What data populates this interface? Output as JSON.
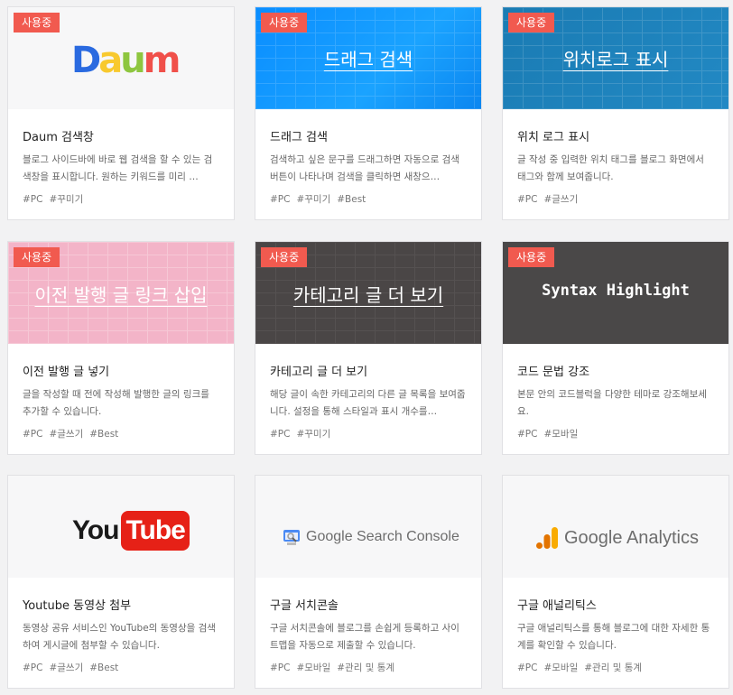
{
  "badge_label": "사용중",
  "cards": [
    {
      "title": "Daum 검색창",
      "description": "블로그 사이드바에 바로 웹 검색을 할 수 있는 검색창을 표시합니다. 원하는 키워드를 미리 …",
      "tags": [
        "#PC",
        "#꾸미기"
      ],
      "thumb": {
        "type": "logo",
        "text": "Daum",
        "letters": [
          "D",
          "a",
          "u",
          "m"
        ]
      }
    },
    {
      "title": "드래그 검색",
      "description": "검색하고 싶은 문구를 드래그하면 자동으로 검색 버튼이 나타나며 검색을 클릭하면 새창으…",
      "tags": [
        "#PC",
        "#꾸미기",
        "#Best"
      ],
      "thumb": {
        "type": "text",
        "text": "드래그 검색"
      }
    },
    {
      "title": "위치 로그 표시",
      "description": "글 작성 중 입력한 위치 태그를 블로그 화면에서 태그와 함께 보여줍니다.",
      "tags": [
        "#PC",
        "#글쓰기"
      ],
      "thumb": {
        "type": "text",
        "text": "위치로그 표시"
      }
    },
    {
      "title": "이전 발행 글 넣기",
      "description": "글을 작성할 때 전에 작성해 발행한 글의 링크를 추가할 수 있습니다.",
      "tags": [
        "#PC",
        "#글쓰기",
        "#Best"
      ],
      "thumb": {
        "type": "text",
        "text": "이전 발행 글 링크 삽입"
      }
    },
    {
      "title": "카테고리 글 더 보기",
      "description": "해당 글이 속한 카테고리의 다른 글 목록을 보여줍니다. 설정을 통해 스타일과 표시 개수를…",
      "tags": [
        "#PC",
        "#꾸미기"
      ],
      "thumb": {
        "type": "text",
        "text": "카테고리 글 더 보기"
      }
    },
    {
      "title": "코드 문법 강조",
      "description": "본문 안의 코드블럭을 다양한 테마로 강조해보세요.",
      "tags": [
        "#PC",
        "#모바일"
      ],
      "thumb": {
        "type": "code",
        "text": "Syntax Highlight"
      }
    },
    {
      "title": "Youtube 동영상 첨부",
      "description": "동영상 공유 서비스인 YouTube의 동영상을 검색하여 게시글에 첨부할 수 있습니다.",
      "tags": [
        "#PC",
        "#글쓰기",
        "#Best"
      ],
      "thumb": {
        "type": "logo",
        "text_a": "You",
        "text_b": "Tube"
      }
    },
    {
      "title": "구글 서치콘솔",
      "description": "구글 서치콘솔에 블로그를 손쉽게 등록하고 사이트맵을 자동으로 제출할 수 있습니다.",
      "tags": [
        "#PC",
        "#모바일",
        "#관리 및 통계"
      ],
      "thumb": {
        "type": "logo",
        "text": "Google Search Console"
      }
    },
    {
      "title": "구글 애널리틱스",
      "description": "구글 애널리틱스를 통해 블로그에 대한 자세한 통계를 확인할 수 있습니다.",
      "tags": [
        "#PC",
        "#모바일",
        "#관리 및 통계"
      ],
      "thumb": {
        "type": "logo",
        "text": "Google Analytics"
      }
    }
  ]
}
